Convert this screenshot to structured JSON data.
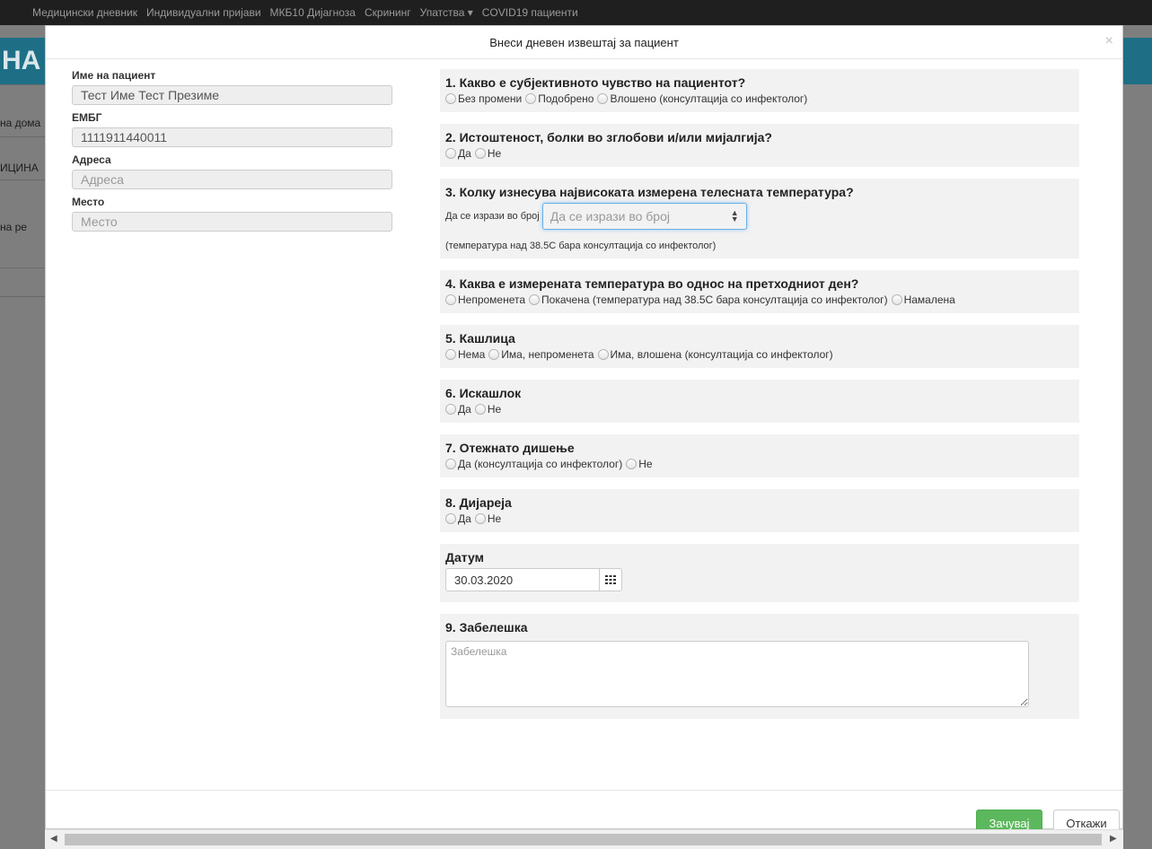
{
  "background": {
    "nav_items": [
      "Медицински дневник",
      "Индивидуални пријави",
      "МКБ10 Дијагноза",
      "Скрининг",
      "Упатства ▾",
      "COVID19 пациенти"
    ],
    "brand_fragment": "НА",
    "fragments": [
      "на дома",
      "ИЦИНА",
      "на ре"
    ]
  },
  "modal": {
    "title": "Внеси дневен извештај за пациент",
    "close_symbol": "×"
  },
  "patient": {
    "name_label": "Име на пациент",
    "name_value": "Тест Име Тест Презиме",
    "embg_label": "ЕМБГ",
    "embg_value": "1111911440011",
    "address_label": "Адреса",
    "address_placeholder": "Адреса",
    "place_label": "Место",
    "place_placeholder": "Место"
  },
  "questions": {
    "q1": {
      "title": "1. Какво е субјективното чувство на пациентот?",
      "options": [
        "Без промени",
        "Подобрено",
        "Влошено (консултација со инфектолог)"
      ]
    },
    "q2": {
      "title": "2. Истоштеност, болки во зглобови и/или мијалгија?",
      "options": [
        "Да",
        "Не"
      ]
    },
    "q3": {
      "title": "3. Колку изнесува највисоката измерена телесната температура?",
      "field_label": "Да се изрази во број",
      "placeholder": "Да се изрази во број",
      "note": "(температура над 38.5С бара консултација со инфектолог)"
    },
    "q4": {
      "title": "4. Каква е измерената температура во однос на претходниот ден?",
      "options": [
        "Непроменета",
        "Покачена (температура над 38.5С бара консултација со инфектолог)",
        "Намалена"
      ]
    },
    "q5": {
      "title": "5. Кашлица",
      "options": [
        "Нема",
        "Има, непроменета",
        "Има, влошена (консултација со инфектолог)"
      ]
    },
    "q6": {
      "title": "6. Искашлок",
      "options": [
        "Да",
        "Не"
      ]
    },
    "q7": {
      "title": "7. Отежнато дишење",
      "options": [
        "Да (консултација со инфектолог)",
        "Не"
      ]
    },
    "q8": {
      "title": "8. Дијареја",
      "options": [
        "Да",
        "Не"
      ]
    }
  },
  "date": {
    "label": "Датум",
    "value": "30.03.2020"
  },
  "note": {
    "label": "9. Забелешка",
    "placeholder": "Забелешка"
  },
  "footer": {
    "save_label": "Зачувај",
    "cancel_label": "Откажи"
  },
  "icons": {
    "calendar": "calendar-icon",
    "spinner": "spinner-icon"
  }
}
